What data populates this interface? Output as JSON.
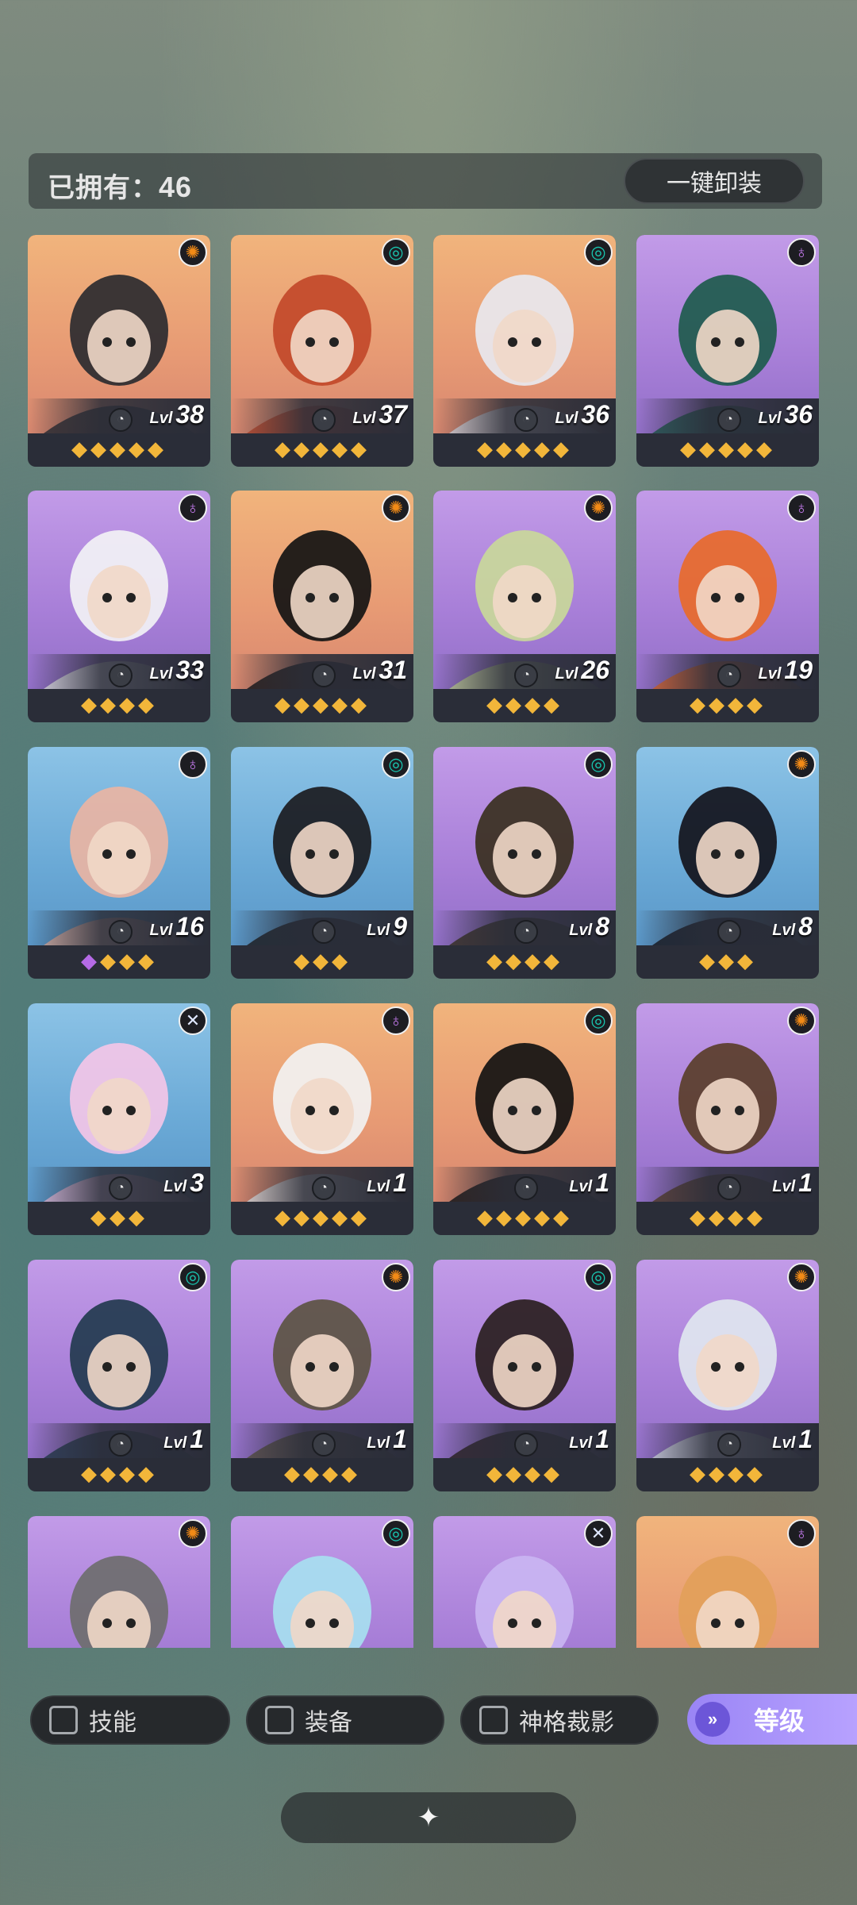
{
  "header": {
    "owned_label": "已拥有：",
    "owned_count": "46",
    "unequip_all": "一键卸装"
  },
  "icons": {
    "faction": [
      "sun-icon",
      "spiral-icon",
      "flame-icon",
      "cross-icon"
    ],
    "level": "level-progress-icon",
    "star": "star-icon",
    "gem": "gem-icon",
    "sort": "chevron-double-down-icon",
    "collapse": "diamond-cluster-icon"
  },
  "heroes": [
    {
      "level": "38",
      "stars": 5,
      "faction": "sun",
      "bg": "orange"
    },
    {
      "level": "37",
      "stars": 5,
      "faction": "spiral",
      "bg": "orange"
    },
    {
      "level": "36",
      "stars": 5,
      "faction": "spiral",
      "bg": "orange"
    },
    {
      "level": "36",
      "stars": 5,
      "faction": "flame",
      "bg": "purple"
    },
    {
      "level": "33",
      "stars": 4,
      "faction": "flame",
      "bg": "purple"
    },
    {
      "level": "31",
      "stars": 5,
      "faction": "sun",
      "bg": "orange"
    },
    {
      "level": "26",
      "stars": 4,
      "faction": "sun",
      "bg": "purple"
    },
    {
      "level": "19",
      "stars": 4,
      "faction": "flame",
      "bg": "purple"
    },
    {
      "level": "16",
      "stars": 3,
      "gem": true,
      "faction": "flame",
      "bg": "blue"
    },
    {
      "level": "9",
      "stars": 3,
      "faction": "spiral",
      "bg": "blue"
    },
    {
      "level": "8",
      "stars": 4,
      "faction": "spiral",
      "bg": "purple"
    },
    {
      "level": "8",
      "stars": 3,
      "faction": "sun",
      "bg": "blue"
    },
    {
      "level": "3",
      "stars": 3,
      "faction": "cross",
      "bg": "blue"
    },
    {
      "level": "1",
      "stars": 5,
      "faction": "flame",
      "bg": "orange"
    },
    {
      "level": "1",
      "stars": 5,
      "faction": "spiral",
      "bg": "orange"
    },
    {
      "level": "1",
      "stars": 4,
      "faction": "sun",
      "bg": "purple"
    },
    {
      "level": "1",
      "stars": 4,
      "faction": "spiral",
      "bg": "purple"
    },
    {
      "level": "1",
      "stars": 4,
      "faction": "sun",
      "bg": "purple"
    },
    {
      "level": "1",
      "stars": 4,
      "faction": "spiral",
      "bg": "purple"
    },
    {
      "level": "1",
      "stars": 4,
      "faction": "sun",
      "bg": "purple"
    },
    {
      "level": "",
      "stars": 0,
      "faction": "sun",
      "bg": "purple"
    },
    {
      "level": "",
      "stars": 0,
      "faction": "spiral",
      "bg": "purple"
    },
    {
      "level": "",
      "stars": 0,
      "faction": "cross",
      "bg": "purple"
    },
    {
      "level": "",
      "stars": 0,
      "faction": "flame",
      "bg": "orange"
    }
  ],
  "level_prefix": "Lvl",
  "filters": {
    "skill": "技能",
    "equipment": "装备",
    "divinity_shadow": "神格裁影",
    "sort": "等级"
  }
}
